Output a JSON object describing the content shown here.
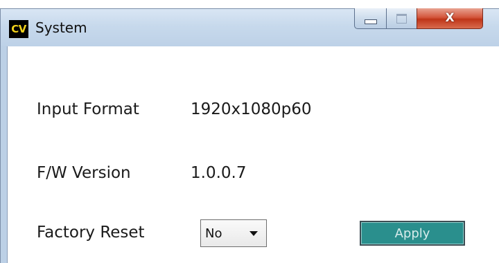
{
  "window": {
    "title": "System",
    "app_icon_text": "CV",
    "icons": {
      "app": "cv-app-icon",
      "minimize": "minimize-icon",
      "maximize": "maximize-icon",
      "close": "close-icon"
    },
    "close_glyph": "X"
  },
  "fields": {
    "input_format": {
      "label": "Input Format",
      "value": "1920x1080p60"
    },
    "fw_version": {
      "label": "F/W Version",
      "value": "1.0.0.7"
    },
    "factory_reset": {
      "label": "Factory Reset",
      "selected": "No",
      "apply_label": "Apply"
    }
  },
  "colors": {
    "apply_button": "#2a8f8d",
    "close_button": "#c7432a",
    "app_icon_text": "#f2d21b"
  }
}
